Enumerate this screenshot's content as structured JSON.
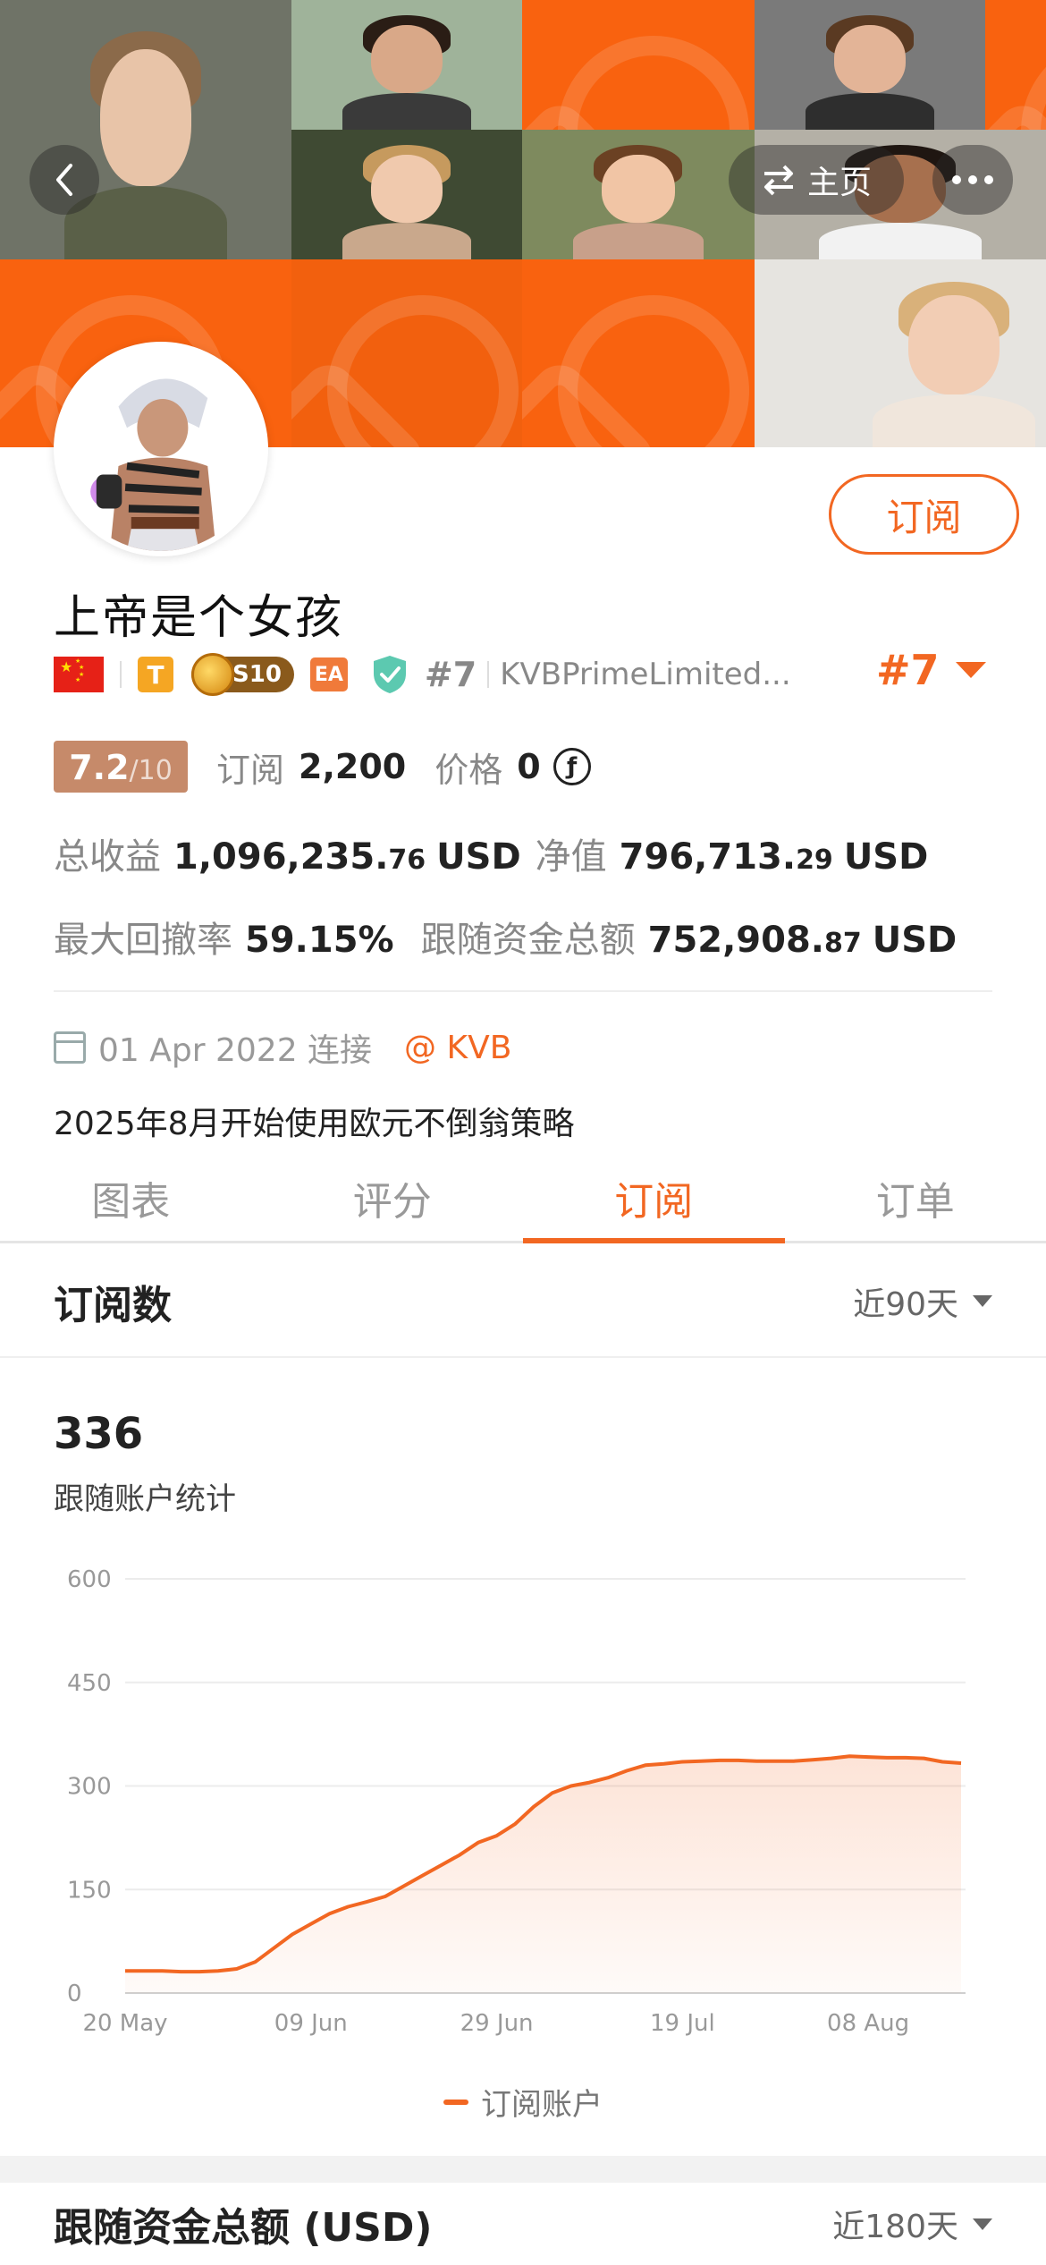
{
  "header": {
    "back_icon": "chevron-left-icon",
    "home_label": "主页",
    "home_icon": "swap-arrows-icon",
    "more_icon": "ellipsis-icon"
  },
  "profile": {
    "name": "上帝是个女孩",
    "subscribe_label": "订阅",
    "country_flag": "china-flag-icon",
    "badge_t": "T",
    "badge_level": "S10",
    "badge_ea": "EA",
    "rank_small": "#7",
    "broker": "KVBPrimeLimited...",
    "rank": "#7"
  },
  "stats": {
    "score": "7.2",
    "score_max": "/10",
    "subscriptions_label": "订阅",
    "subscriptions_value": "2,200",
    "price_label": "价格",
    "price_value": "0",
    "price_currency_icon": "ƒ",
    "total_profit_label": "总收益",
    "total_profit_int": "1,096,235.",
    "total_profit_dec": "76",
    "net_value_label": "净值",
    "net_value_int": "796,713.",
    "net_value_dec": "29",
    "currency": "USD",
    "max_drawdown_label": "最大回撤率",
    "max_drawdown_value": "59.15%",
    "follow_funds_label": "跟随资金总额",
    "follow_funds_int": "752,908.",
    "follow_funds_dec": "87"
  },
  "connection": {
    "date": "01 Apr 2022 连接",
    "broker_at": "@ KVB"
  },
  "bio": "2025年8月开始使用欧元不倒翁策略",
  "tabs": [
    {
      "label": "图表",
      "active": false
    },
    {
      "label": "评分",
      "active": false
    },
    {
      "label": "订阅",
      "active": true
    },
    {
      "label": "订单",
      "active": false
    }
  ],
  "subscriptions_section": {
    "title": "订阅数",
    "range": "近90天",
    "count": "336",
    "count_label": "跟随账户统计",
    "legend": "订阅账户"
  },
  "funds_section": {
    "title": "跟随资金总额 (USD)",
    "range": "近180天"
  },
  "colors": {
    "accent": "#f26722",
    "banner": "#f9620f",
    "score_bg": "#c68a6a"
  },
  "chart_data": {
    "type": "area",
    "x_ticks": [
      "20 May",
      "09 Jun",
      "29 Jun",
      "19 Jul",
      "08 Aug"
    ],
    "y_ticks": [
      0,
      150,
      300,
      450,
      600
    ],
    "ylim": [
      0,
      600
    ],
    "grid": true,
    "legend_position": "bottom",
    "series": [
      {
        "name": "订阅账户",
        "x": [
          "20 May",
          "22 May",
          "24 May",
          "26 May",
          "28 May",
          "30 May",
          "01 Jun",
          "03 Jun",
          "05 Jun",
          "07 Jun",
          "09 Jun",
          "11 Jun",
          "13 Jun",
          "15 Jun",
          "17 Jun",
          "19 Jun",
          "21 Jun",
          "23 Jun",
          "25 Jun",
          "27 Jun",
          "29 Jun",
          "01 Jul",
          "03 Jul",
          "05 Jul",
          "07 Jul",
          "09 Jul",
          "11 Jul",
          "13 Jul",
          "15 Jul",
          "17 Jul",
          "19 Jul",
          "21 Jul",
          "23 Jul",
          "25 Jul",
          "27 Jul",
          "29 Jul",
          "31 Jul",
          "02 Aug",
          "04 Aug",
          "06 Aug",
          "08 Aug",
          "10 Aug",
          "12 Aug",
          "14 Aug",
          "16 Aug",
          "18 Aug"
        ],
        "values": [
          32,
          32,
          32,
          31,
          31,
          32,
          35,
          45,
          65,
          85,
          100,
          115,
          125,
          132,
          140,
          155,
          170,
          185,
          200,
          218,
          228,
          245,
          270,
          290,
          300,
          305,
          312,
          322,
          330,
          332,
          335,
          336,
          337,
          337,
          336,
          336,
          336,
          338,
          340,
          343,
          342,
          341,
          341,
          340,
          335,
          333
        ]
      }
    ]
  }
}
